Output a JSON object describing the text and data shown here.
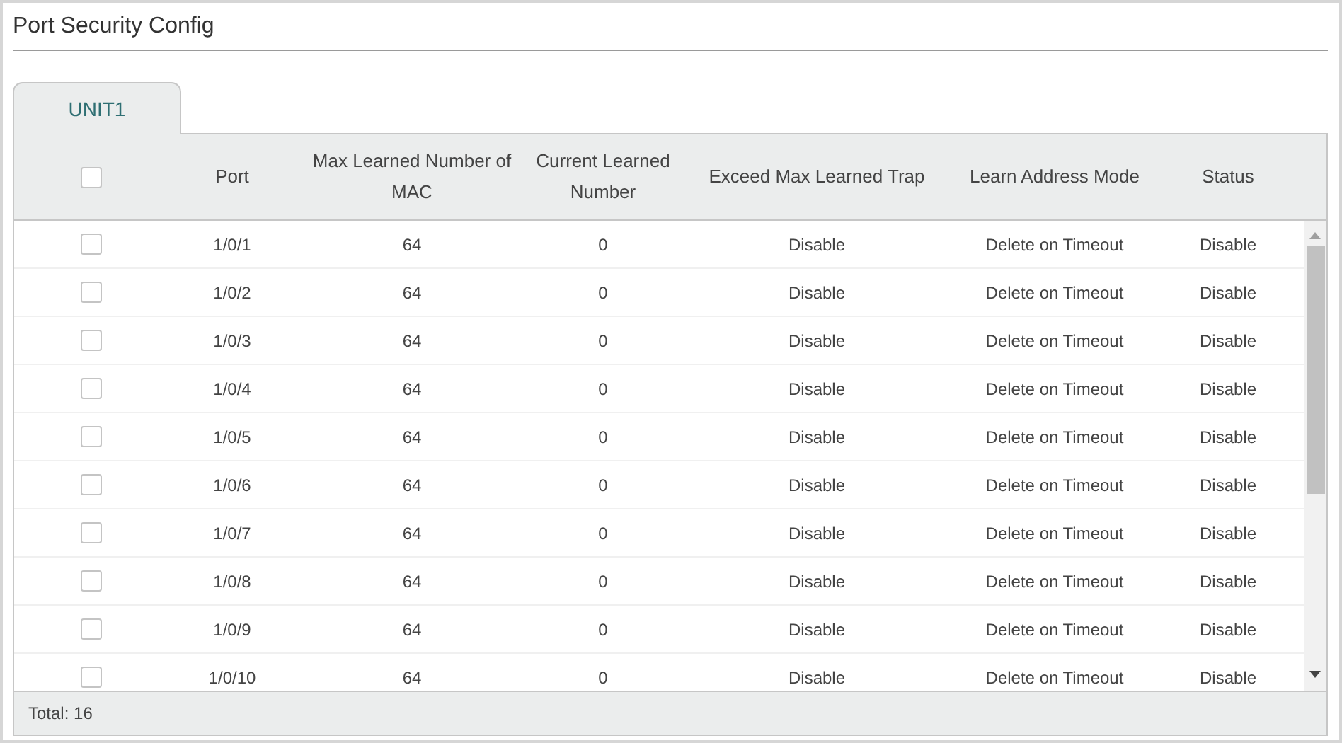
{
  "title": "Port Security Config",
  "tabs": [
    {
      "label": "UNIT1",
      "selected": true
    }
  ],
  "table": {
    "select_all": {
      "checked": false
    },
    "columns": [
      "Port",
      "Max Learned Number of MAC",
      "Current Learned Number",
      "Exceed Max Learned Trap",
      "Learn Address Mode",
      "Status"
    ],
    "rows": [
      {
        "checked": false,
        "cells": [
          "1/0/1",
          "64",
          "0",
          "Disable",
          "Delete on Timeout",
          "Disable"
        ]
      },
      {
        "checked": false,
        "cells": [
          "1/0/2",
          "64",
          "0",
          "Disable",
          "Delete on Timeout",
          "Disable"
        ]
      },
      {
        "checked": false,
        "cells": [
          "1/0/3",
          "64",
          "0",
          "Disable",
          "Delete on Timeout",
          "Disable"
        ]
      },
      {
        "checked": false,
        "cells": [
          "1/0/4",
          "64",
          "0",
          "Disable",
          "Delete on Timeout",
          "Disable"
        ]
      },
      {
        "checked": false,
        "cells": [
          "1/0/5",
          "64",
          "0",
          "Disable",
          "Delete on Timeout",
          "Disable"
        ]
      },
      {
        "checked": false,
        "cells": [
          "1/0/6",
          "64",
          "0",
          "Disable",
          "Delete on Timeout",
          "Disable"
        ]
      },
      {
        "checked": false,
        "cells": [
          "1/0/7",
          "64",
          "0",
          "Disable",
          "Delete on Timeout",
          "Disable"
        ]
      },
      {
        "checked": false,
        "cells": [
          "1/0/8",
          "64",
          "0",
          "Disable",
          "Delete on Timeout",
          "Disable"
        ]
      },
      {
        "checked": false,
        "cells": [
          "1/0/9",
          "64",
          "0",
          "Disable",
          "Delete on Timeout",
          "Disable"
        ]
      },
      {
        "checked": false,
        "cells": [
          "1/0/10",
          "64",
          "0",
          "Disable",
          "Delete on Timeout",
          "Disable"
        ]
      }
    ],
    "footer": "Total: 16"
  }
}
